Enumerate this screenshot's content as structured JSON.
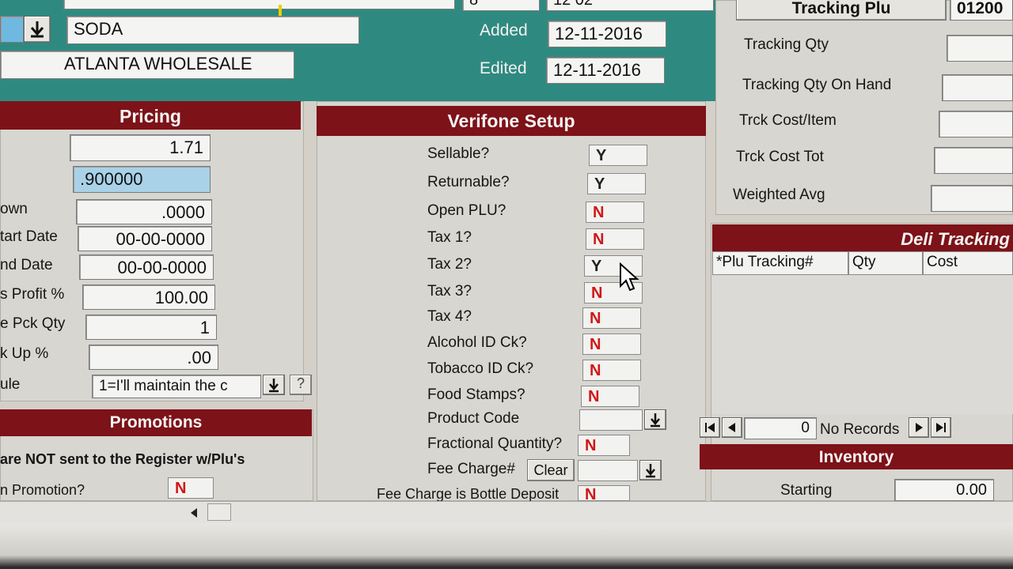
{
  "top": {
    "top_left_value": "8",
    "top_right_value": "12 02",
    "department": "SODA",
    "vendor": "ATLANTA WHOLESALE",
    "added_label": "Added",
    "added_value": "12-11-2016",
    "edited_label": "Edited",
    "edited_value": "12-11-2016"
  },
  "pricing": {
    "title": "Pricing",
    "price": "1.71",
    "cost": ".900000",
    "down_label": "own",
    "down_value": ".0000",
    "start_label": "tart Date",
    "start_value": "00-00-0000",
    "end_label": "nd Date",
    "end_value": "00-00-0000",
    "profit_label": "s Profit %",
    "profit_value": "100.00",
    "pack_label": "e Pck Qty",
    "pack_value": "1",
    "markup_label": "k Up %",
    "markup_value": ".00",
    "rule_label": "ule",
    "rule_value": "1=I'll maintain the c",
    "help_label": "?"
  },
  "promotions": {
    "title": "Promotions",
    "note": "are NOT sent to the Register w/Plu's",
    "promo_label": "n Promotion?",
    "promo_value": "N"
  },
  "verifone": {
    "title": "Verifone Setup",
    "rows": [
      {
        "label": "Sellable?",
        "value": "Y"
      },
      {
        "label": "Returnable?",
        "value": "Y"
      },
      {
        "label": "Open PLU?",
        "value": "N"
      },
      {
        "label": "Tax 1?",
        "value": "N"
      },
      {
        "label": "Tax 2?",
        "value": "Y"
      },
      {
        "label": "Tax 3?",
        "value": "N"
      },
      {
        "label": "Tax 4?",
        "value": "N"
      },
      {
        "label": "Alcohol ID Ck?",
        "value": "N"
      },
      {
        "label": "Tobacco ID Ck?",
        "value": "N"
      },
      {
        "label": "Food Stamps?",
        "value": "N"
      }
    ],
    "product_code_label": "Product Code",
    "product_code_value": "",
    "fractional_label": "Fractional Quantity?",
    "fractional_value": "N",
    "fee_label": "Fee Charge#",
    "clear_label": "Clear",
    "fee_value": "",
    "bottle_label": "Fee Charge is Bottle Deposit",
    "bottle_value": "N"
  },
  "tracking": {
    "plu_label": "Tracking Plu",
    "plu_value": "01200",
    "qty_label": "Tracking Qty",
    "onhand_label": "Tracking Qty On Hand",
    "costitem_label": "Trck Cost/Item",
    "costtot_label": "Trck Cost Tot",
    "wavg_label": "Weighted Avg"
  },
  "deli": {
    "title": "Deli Tracking",
    "columns": [
      "*Plu Tracking#",
      "Qty",
      "Cost"
    ],
    "nav_count": "0",
    "nav_status": "No Records"
  },
  "inventory": {
    "title": "Inventory",
    "starting_label": "Starting",
    "starting_value": "0.00"
  }
}
